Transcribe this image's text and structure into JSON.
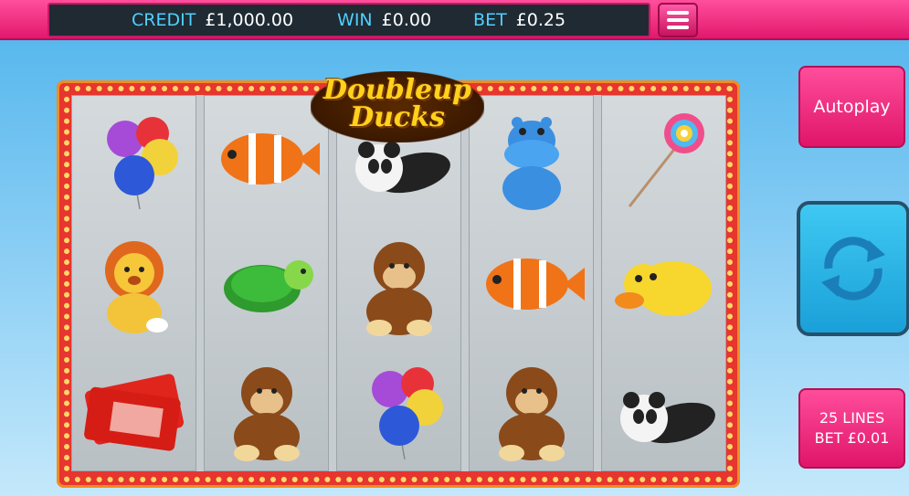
{
  "header": {
    "credit_label": "CREDIT",
    "credit_value": "£1,000.00",
    "win_label": "WIN",
    "win_value": "£0.00",
    "bet_label": "BET",
    "bet_value": "£0.25",
    "menu_icon": "hamburger-menu-icon"
  },
  "logo": {
    "line1": "Doubleup",
    "line2": "Ducks"
  },
  "reels": [
    [
      "balloons",
      "lion",
      "admit-one-ticket"
    ],
    [
      "clownfish",
      "turtle",
      "monkey"
    ],
    [
      "panda",
      "monkey",
      "balloons"
    ],
    [
      "hippo",
      "clownfish",
      "monkey"
    ],
    [
      "lollipop",
      "duck",
      "panda"
    ]
  ],
  "controls": {
    "autoplay_label": "Autoplay",
    "spin_icon": "spin-arrows-icon",
    "lines_label": "25 LINES",
    "line_bet_label": "BET £0.01"
  },
  "colors": {
    "accent_pink": "#e2186d",
    "spin_blue": "#1aa0d8",
    "label_cyan": "#4fd0ff"
  }
}
